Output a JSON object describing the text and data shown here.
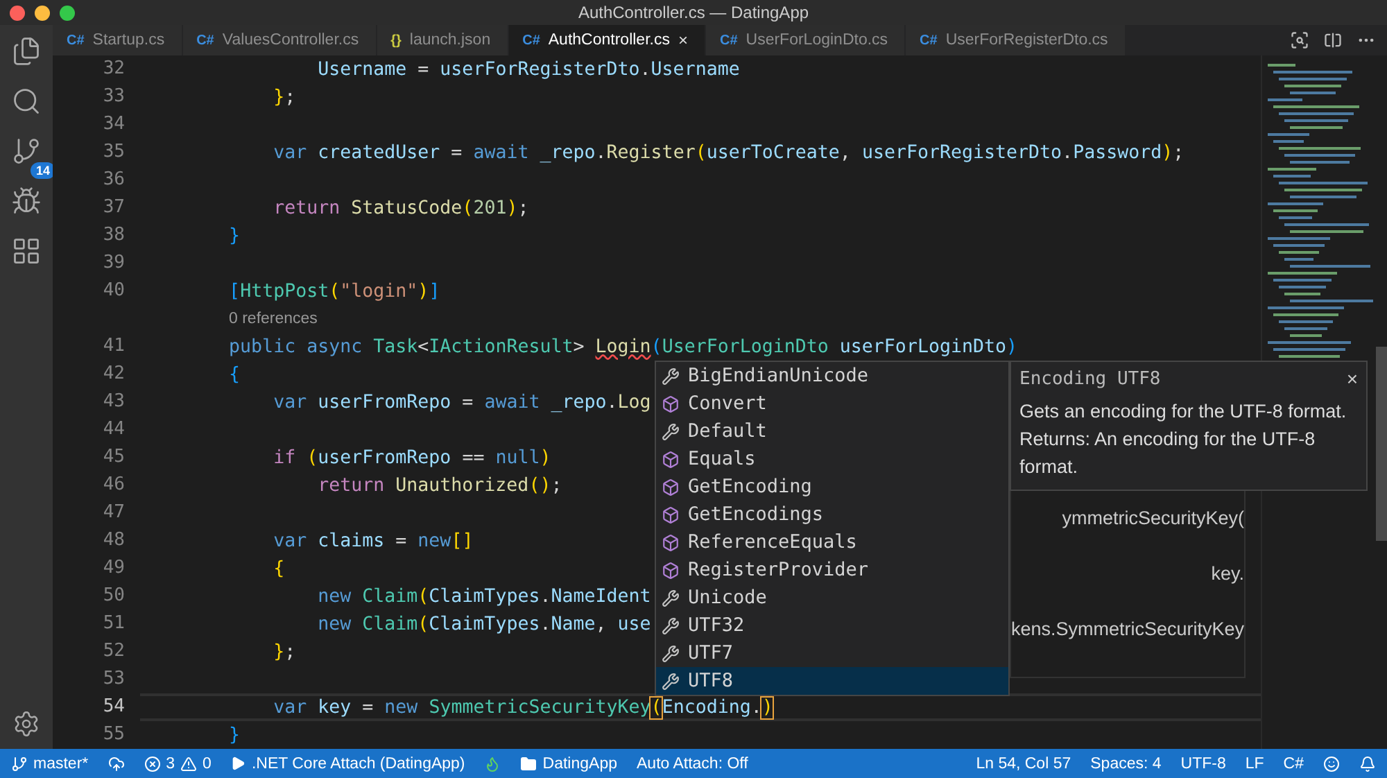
{
  "window": {
    "title": "AuthController.cs — DatingApp"
  },
  "activity": {
    "scm_badge": "14"
  },
  "tabs": [
    {
      "kind": "cs",
      "icon": "C#",
      "label": "Startup.cs",
      "selected": false
    },
    {
      "kind": "cs",
      "icon": "C#",
      "label": "ValuesController.cs",
      "selected": false
    },
    {
      "kind": "json",
      "icon": "{}",
      "label": "launch.json",
      "selected": false
    },
    {
      "kind": "cs",
      "icon": "C#",
      "label": "AuthController.cs",
      "selected": true,
      "close": "×"
    },
    {
      "kind": "cs",
      "icon": "C#",
      "label": "UserForLoginDto.cs",
      "selected": false
    },
    {
      "kind": "cs",
      "icon": "C#",
      "label": "UserForRegisterDto.cs",
      "selected": false
    }
  ],
  "lines": [
    {
      "kind": "code",
      "number": "32",
      "current": false,
      "tokens": [
        {
          "kind": "var",
          "text": "                Username"
        },
        {
          "kind": "p",
          "text": " = "
        },
        {
          "kind": "var",
          "text": "userForRegisterDto"
        },
        {
          "kind": "p",
          "text": "."
        },
        {
          "kind": "var",
          "text": "Username"
        }
      ]
    },
    {
      "kind": "code",
      "number": "33",
      "current": false,
      "tokens": [
        {
          "kind": "br",
          "text": "            }"
        },
        {
          "kind": "p",
          "text": ";"
        }
      ]
    },
    {
      "kind": "code",
      "number": "34",
      "current": false
    },
    {
      "kind": "code",
      "number": "35",
      "current": false,
      "tokens": [
        {
          "kind": "kw",
          "text": "            var "
        },
        {
          "kind": "var",
          "text": "createdUser"
        },
        {
          "kind": "p",
          "text": " = "
        },
        {
          "kind": "kw",
          "text": "await "
        },
        {
          "kind": "var",
          "text": "_repo"
        },
        {
          "kind": "p",
          "text": "."
        },
        {
          "kind": "fn",
          "text": "Register"
        },
        {
          "kind": "br",
          "text": "("
        },
        {
          "kind": "var",
          "text": "userToCreate"
        },
        {
          "kind": "p",
          "text": ", "
        },
        {
          "kind": "var",
          "text": "userForRegisterDto"
        },
        {
          "kind": "p",
          "text": "."
        },
        {
          "kind": "var",
          "text": "Password"
        },
        {
          "kind": "br",
          "text": ")"
        },
        {
          "kind": "p",
          "text": ";"
        }
      ]
    },
    {
      "kind": "code",
      "number": "36",
      "current": false
    },
    {
      "kind": "code",
      "number": "37",
      "current": false,
      "tokens": [
        {
          "kind": "ctrl",
          "text": "            return "
        },
        {
          "kind": "fn",
          "text": "StatusCode"
        },
        {
          "kind": "br",
          "text": "("
        },
        {
          "kind": "num",
          "text": "201"
        },
        {
          "kind": "br",
          "text": ")"
        },
        {
          "kind": "p",
          "text": ";"
        }
      ]
    },
    {
      "kind": "code",
      "number": "38",
      "current": false,
      "tokens": [
        {
          "kind": "br2",
          "text": "        }"
        }
      ]
    },
    {
      "kind": "code",
      "number": "39",
      "current": false
    },
    {
      "kind": "code",
      "number": "40",
      "current": false,
      "tokens": [
        {
          "kind": "br2",
          "text": "        ["
        },
        {
          "kind": "type",
          "text": "HttpPost"
        },
        {
          "kind": "br",
          "text": "("
        },
        {
          "kind": "str",
          "text": "\"login\""
        },
        {
          "kind": "br",
          "text": ")"
        },
        {
          "kind": "br2",
          "text": "]"
        }
      ]
    },
    {
      "kind": "codelens",
      "text": "0 references"
    },
    {
      "kind": "code",
      "number": "41",
      "current": false,
      "tokens": [
        {
          "kind": "kw",
          "text": "        public async "
        },
        {
          "kind": "type",
          "text": "Task"
        },
        {
          "kind": "p",
          "text": "<"
        },
        {
          "kind": "type",
          "text": "IActionResult"
        },
        {
          "kind": "p",
          "text": "> "
        },
        {
          "kind": "fn_err",
          "text": "Login"
        },
        {
          "kind": "br2",
          "text": "("
        },
        {
          "kind": "type",
          "text": "UserForLoginDto "
        },
        {
          "kind": "var",
          "text": "userForLoginDto"
        },
        {
          "kind": "br2",
          "text": ")"
        }
      ]
    },
    {
      "kind": "code",
      "number": "42",
      "current": false,
      "tokens": [
        {
          "kind": "br2",
          "text": "        {"
        }
      ]
    },
    {
      "kind": "code",
      "number": "43",
      "current": false,
      "tokens": [
        {
          "kind": "kw",
          "text": "            var "
        },
        {
          "kind": "var",
          "text": "userFromRepo"
        },
        {
          "kind": "p",
          "text": " = "
        },
        {
          "kind": "kw",
          "text": "await "
        },
        {
          "kind": "var",
          "text": "_repo"
        },
        {
          "kind": "p",
          "text": "."
        },
        {
          "kind": "fn",
          "text": "Log"
        }
      ]
    },
    {
      "kind": "code",
      "number": "44",
      "current": false
    },
    {
      "kind": "code",
      "number": "45",
      "current": false,
      "tokens": [
        {
          "kind": "ctrl",
          "text": "            if "
        },
        {
          "kind": "br",
          "text": "("
        },
        {
          "kind": "var",
          "text": "userFromRepo"
        },
        {
          "kind": "p",
          "text": " == "
        },
        {
          "kind": "kw",
          "text": "null"
        },
        {
          "kind": "br",
          "text": ")"
        }
      ]
    },
    {
      "kind": "code",
      "number": "46",
      "current": false,
      "tokens": [
        {
          "kind": "ctrl",
          "text": "                return "
        },
        {
          "kind": "fn",
          "text": "Unauthorized"
        },
        {
          "kind": "br",
          "text": "()"
        },
        {
          "kind": "p",
          "text": ";"
        }
      ]
    },
    {
      "kind": "code",
      "number": "47",
      "current": false
    },
    {
      "kind": "code",
      "number": "48",
      "current": false,
      "tokens": [
        {
          "kind": "kw",
          "text": "            var "
        },
        {
          "kind": "var",
          "text": "claims"
        },
        {
          "kind": "p",
          "text": " = "
        },
        {
          "kind": "kw",
          "text": "new"
        },
        {
          "kind": "br",
          "text": "[]"
        }
      ]
    },
    {
      "kind": "code",
      "number": "49",
      "current": false,
      "tokens": [
        {
          "kind": "br",
          "text": "            {"
        }
      ]
    },
    {
      "kind": "code",
      "number": "50",
      "current": false,
      "tokens": [
        {
          "kind": "kw",
          "text": "                new "
        },
        {
          "kind": "type",
          "text": "Claim"
        },
        {
          "kind": "br",
          "text": "("
        },
        {
          "kind": "var",
          "text": "ClaimTypes"
        },
        {
          "kind": "p",
          "text": "."
        },
        {
          "kind": "var",
          "text": "NameIdent"
        }
      ]
    },
    {
      "kind": "code",
      "number": "51",
      "current": false,
      "tokens": [
        {
          "kind": "kw",
          "text": "                new "
        },
        {
          "kind": "type",
          "text": "Claim"
        },
        {
          "kind": "br",
          "text": "("
        },
        {
          "kind": "var",
          "text": "ClaimTypes"
        },
        {
          "kind": "p",
          "text": "."
        },
        {
          "kind": "var",
          "text": "Name"
        },
        {
          "kind": "p",
          "text": ", "
        },
        {
          "kind": "var",
          "text": "use"
        }
      ]
    },
    {
      "kind": "code",
      "number": "52",
      "current": false,
      "tokens": [
        {
          "kind": "br",
          "text": "            }"
        },
        {
          "kind": "p",
          "text": ";"
        }
      ]
    },
    {
      "kind": "code",
      "number": "53",
      "current": false
    },
    {
      "kind": "code",
      "number": "54",
      "current": true,
      "tokens": [
        {
          "kind": "kw",
          "text": "            var "
        },
        {
          "kind": "var",
          "text": "key"
        },
        {
          "kind": "p",
          "text": " = "
        },
        {
          "kind": "kw",
          "text": "new "
        },
        {
          "kind": "type",
          "text": "SymmetricSecurityKey"
        },
        {
          "kind": "match",
          "text": "("
        },
        {
          "kind": "var",
          "text": "Encoding"
        },
        {
          "kind": "p",
          "text": "."
        },
        {
          "kind": "match",
          "text": ")"
        }
      ]
    },
    {
      "kind": "code",
      "number": "55",
      "current": false,
      "tokens": [
        {
          "kind": "br2",
          "text": "        }"
        }
      ]
    }
  ],
  "suggest": {
    "items": [
      {
        "kind": "property",
        "label": "BigEndianUnicode",
        "selected": false
      },
      {
        "kind": "method",
        "label": "Convert",
        "selected": false
      },
      {
        "kind": "property",
        "label": "Default",
        "selected": false
      },
      {
        "kind": "method",
        "label": "Equals",
        "selected": false
      },
      {
        "kind": "method",
        "label": "GetEncoding",
        "selected": false
      },
      {
        "kind": "method",
        "label": "GetEncodings",
        "selected": false
      },
      {
        "kind": "method",
        "label": "ReferenceEquals",
        "selected": false
      },
      {
        "kind": "method",
        "label": "RegisterProvider",
        "selected": false
      },
      {
        "kind": "property",
        "label": "Unicode",
        "selected": false
      },
      {
        "kind": "property",
        "label": "UTF32",
        "selected": false
      },
      {
        "kind": "property",
        "label": "UTF7",
        "selected": false
      },
      {
        "kind": "property",
        "label": "UTF8",
        "selected": true
      }
    ],
    "details": {
      "title": "Encoding UTF8",
      "close": "×",
      "paragraphs": [
        "Gets an encoding for the UTF-8 format.",
        "Returns: An encoding for the UTF-8 format."
      ]
    }
  },
  "hidden_hint": {
    "fragments": [
      "ymmetricSecurityKey(",
      "key.",
      "kens.SymmetricSecurityKey"
    ]
  },
  "status_bar": {
    "branch": "master*",
    "errors": "3",
    "warnings": "0",
    "debug": ".NET Core Attach (DatingApp)",
    "folder": "DatingApp",
    "auto_attach": "Auto Attach: Off",
    "position": "Ln 54, Col 57",
    "spaces": "Spaces: 4",
    "encoding": "UTF-8",
    "eol": "LF",
    "language": "C#"
  }
}
